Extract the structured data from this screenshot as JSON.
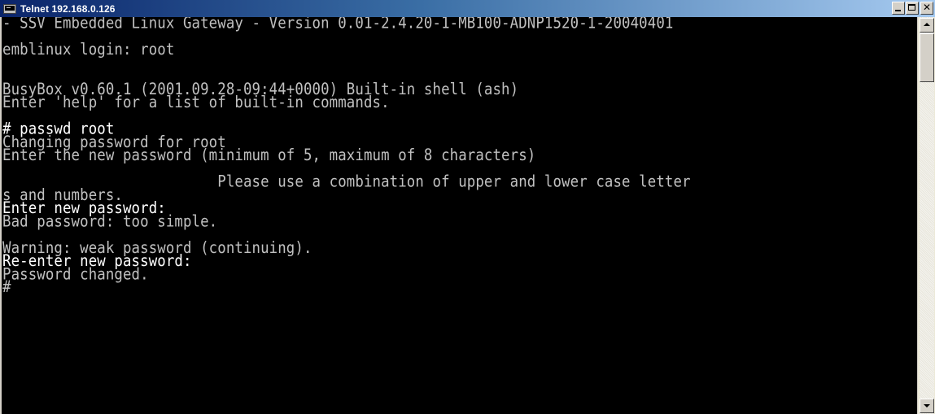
{
  "window": {
    "title": "Telnet 192.168.0.126",
    "icon": "console-icon",
    "buttons": {
      "minimize": "minimize-icon",
      "maximize": "maximize-icon",
      "close": "close-icon"
    }
  },
  "colors": {
    "console_background": "#000000",
    "console_text": "#c0c0c0",
    "console_text_bright": "#ffffff",
    "titlebar_start": "#0a246a",
    "titlebar_end": "#a6caf0"
  },
  "console": {
    "lines": [
      "- SSV Embedded Linux Gateway - Version 0.01-2.4.20-1-MB100-ADNP1520-1-20040401",
      "",
      "emblinux login: root",
      "",
      "",
      "BusyBox v0.60.1 (2001.09.28-09:44+0000) Built-in shell (ash)",
      "Enter 'help' for a list of built-in commands.",
      "",
      "# passwd root",
      "Changing password for root",
      "Enter the new password (minimum of 5, maximum of 8 characters)",
      "",
      "                         Please use a combination of upper and lower case letter",
      "s and numbers.",
      "Enter new password:",
      "Bad password: too simple.",
      "",
      "Warning: weak password (continuing).",
      "Re-enter new password:",
      "Password changed.",
      "#",
      "",
      ""
    ]
  },
  "scrollbar": {
    "up": "scroll-up-arrow-icon",
    "down": "scroll-down-arrow-icon"
  }
}
